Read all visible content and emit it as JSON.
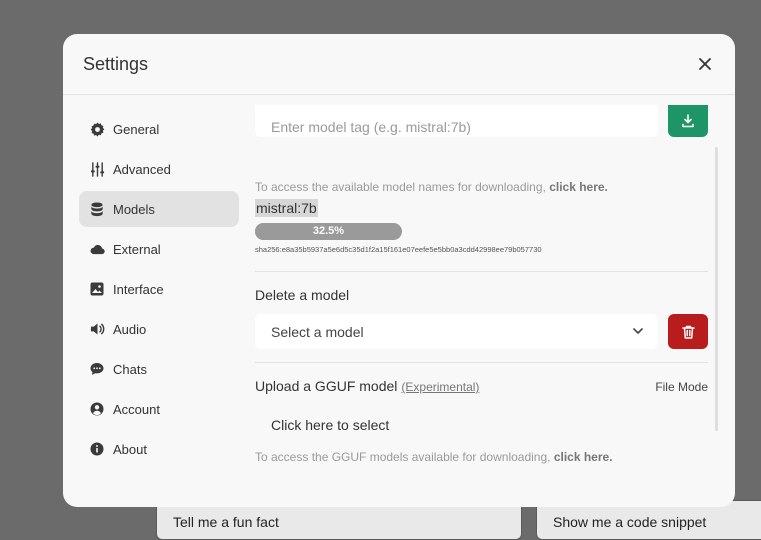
{
  "background": {
    "suggestions": [
      "Tell me a fun fact",
      "Show me a code snippet"
    ]
  },
  "modal": {
    "title": "Settings",
    "close_icon": "close-icon"
  },
  "sidebar": {
    "items": [
      {
        "label": "General",
        "icon": "gear-icon"
      },
      {
        "label": "Advanced",
        "icon": "sliders-icon"
      },
      {
        "label": "Models",
        "icon": "database-icon",
        "active": true
      },
      {
        "label": "External",
        "icon": "cloud-icon"
      },
      {
        "label": "Interface",
        "icon": "image-icon"
      },
      {
        "label": "Audio",
        "icon": "speaker-icon"
      },
      {
        "label": "Chats",
        "icon": "chat-bubble-icon"
      },
      {
        "label": "Account",
        "icon": "user-circle-icon"
      },
      {
        "label": "About",
        "icon": "info-icon"
      }
    ]
  },
  "pull": {
    "placeholder": "Enter model tag (e.g. mistral:7b)",
    "hint_text": "To access the available model names for downloading,",
    "hint_link": "click here.",
    "model_name": "mistral:7b",
    "progress_label": "32.5%",
    "progress_value": 32.5,
    "digest": "sha256:e8a35b5937a5e6d5c35d1f2a15f161e07eefe5e5bb0a3cdd42998ee79b057730"
  },
  "delete": {
    "title": "Delete a model",
    "select_placeholder": "Select a model"
  },
  "upload": {
    "title": "Upload a GGUF model",
    "experimental": "(Experimental)",
    "file_mode": "File Mode",
    "click_select": "Click here to select",
    "hint_text": "To access the GGUF models available for downloading,",
    "hint_link": "click here."
  },
  "colors": {
    "download_button": "#1e9566",
    "delete_button": "#b91c1c",
    "active_sidebar": "#e2e2e2"
  }
}
